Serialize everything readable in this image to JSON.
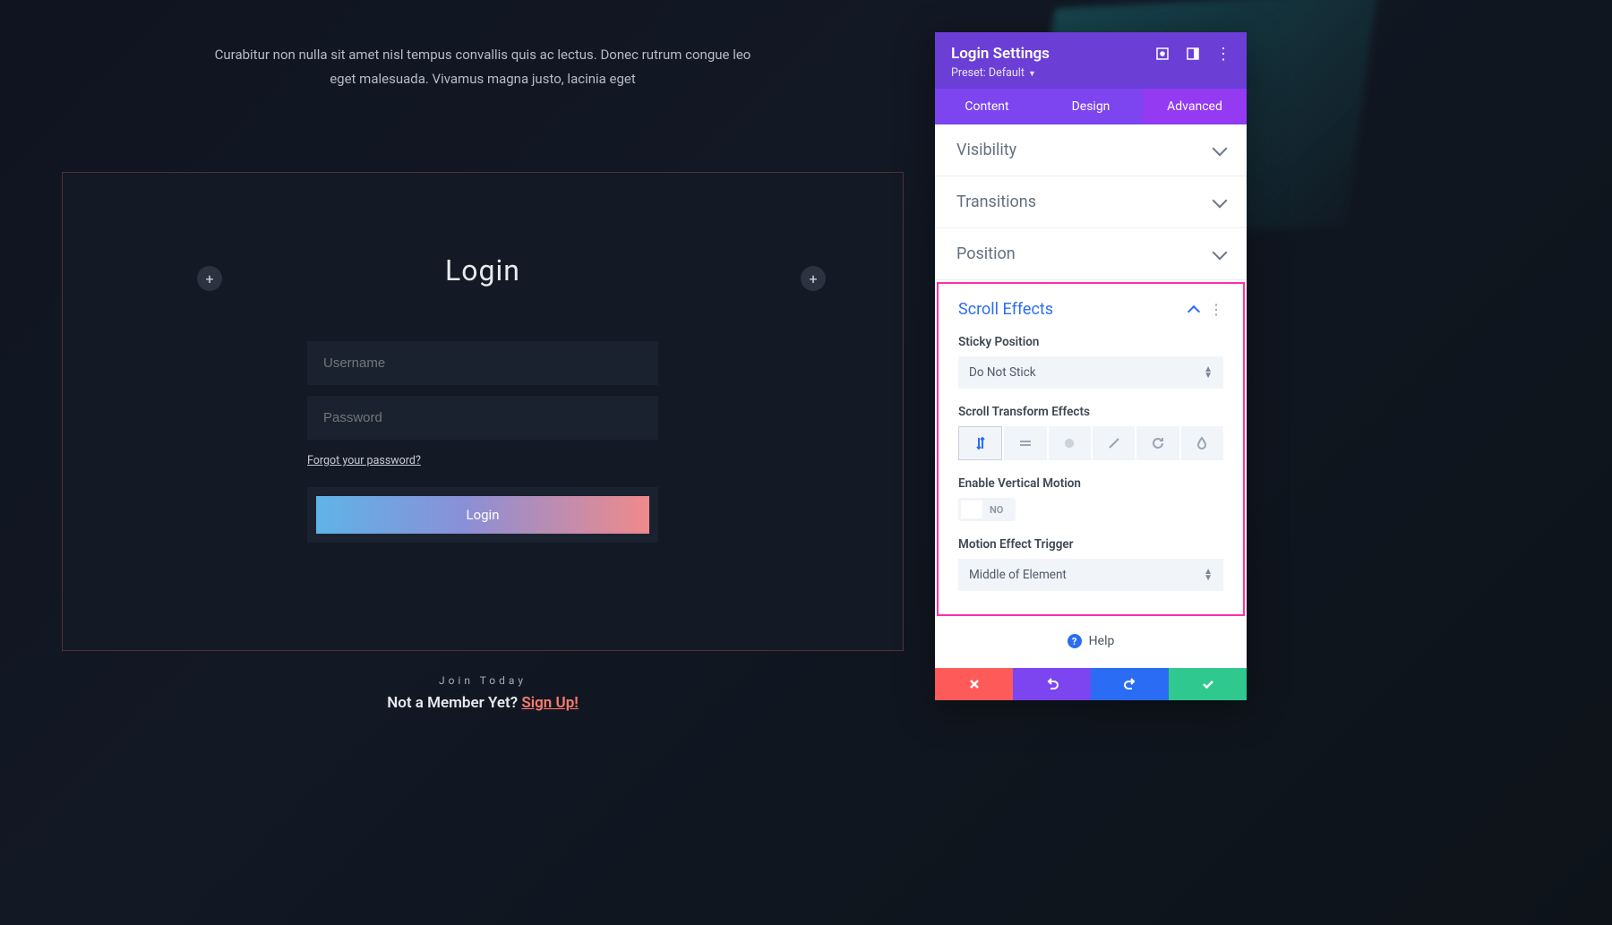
{
  "page": {
    "intro": "Curabitur non nulla sit amet nisl tempus convallis quis ac lectus. Donec rutrum congue leo eget malesuada. Vivamus magna justo, lacinia eget",
    "login_title": "Login",
    "username_placeholder": "Username",
    "password_placeholder": "Password",
    "forgot": "Forgot your password?",
    "login_button": "Login",
    "join_today": "Join Today",
    "not_member": "Not a Member Yet? ",
    "signup": "Sign Up!"
  },
  "panel": {
    "title": "Login Settings",
    "preset": "Preset: Default",
    "tabs": {
      "content": "Content",
      "design": "Design",
      "advanced": "Advanced"
    },
    "sections": {
      "visibility": "Visibility",
      "transitions": "Transitions",
      "position": "Position",
      "scroll_effects": "Scroll Effects"
    },
    "scroll": {
      "sticky_label": "Sticky Position",
      "sticky_value": "Do Not Stick",
      "transform_label": "Scroll Transform Effects",
      "enable_vertical_label": "Enable Vertical Motion",
      "enable_vertical_value": "NO",
      "trigger_label": "Motion Effect Trigger",
      "trigger_value": "Middle of Element"
    },
    "help": "Help"
  }
}
